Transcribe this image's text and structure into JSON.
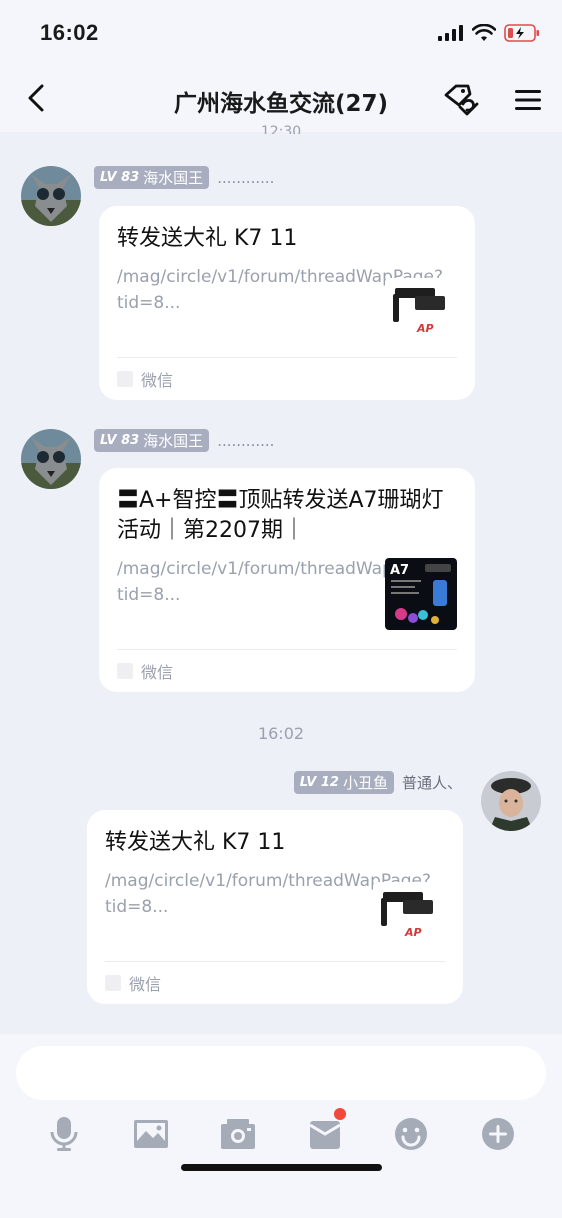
{
  "status_bar": {
    "time": "16:02"
  },
  "header": {
    "title": "广州海水鱼交流(27)",
    "prev_time": "12:30"
  },
  "messages": [
    {
      "level": "LV 83",
      "title_badge": "海水国王",
      "nickname": "............",
      "card": {
        "title": "转发送大礼 K7 11",
        "link": "/mag/circle/v1/forum/threadWapPage?tid=8...",
        "source": "微信"
      }
    },
    {
      "level": "LV 83",
      "title_badge": "海水国王",
      "nickname": "............",
      "card": {
        "title": "〓A+智控〓顶贴转发送A7珊瑚灯活动｜第2207期｜",
        "link": "/mag/circle/v1/forum/threadWapPage?tid=8...",
        "source": "微信",
        "thumb_label": "A7"
      }
    },
    {
      "time": "16:02",
      "level": "LV 12",
      "title_badge": "小丑鱼",
      "nickname": "普通人、",
      "card": {
        "title": "转发送大礼 K7 11",
        "link": "/mag/circle/v1/forum/threadWapPage?tid=8...",
        "source": "微信"
      }
    }
  ],
  "input": {
    "placeholder": ""
  },
  "toolbar": {
    "items": [
      "microphone-icon",
      "image-icon",
      "camera-icon",
      "red-packet-icon",
      "emoji-icon",
      "plus-icon"
    ],
    "notification_color": "#f2483b"
  }
}
